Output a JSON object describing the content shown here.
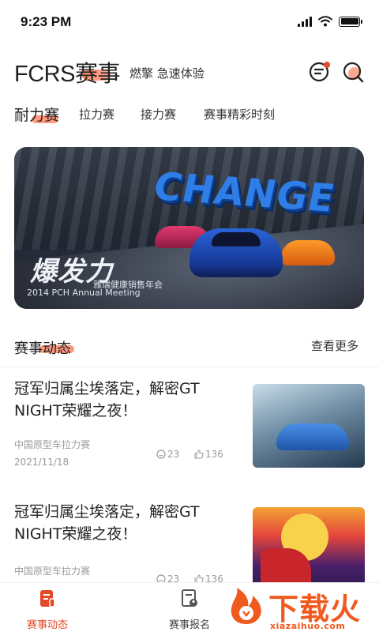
{
  "status_bar": {
    "time": "9:23 PM"
  },
  "header": {
    "title": "FCRS赛事",
    "subtitle": "燃擎 急速体验"
  },
  "tabs": [
    {
      "label": "耐力赛",
      "active": true
    },
    {
      "label": "拉力赛",
      "active": false
    },
    {
      "label": "接力赛",
      "active": false
    },
    {
      "label": "赛事精彩时刻",
      "active": false
    }
  ],
  "banner": {
    "headline": "CHANGE",
    "logo_text": "爆发力",
    "event_text": "2014 PCH Annual Meeting",
    "sub_text": "雅瑞健康销售年会"
  },
  "section": {
    "title": "赛事动态",
    "more_label": "查看更多"
  },
  "news": [
    {
      "title": "冠军归属尘埃落定，解密GT NIGHT荣耀之夜！",
      "source": "中国原型车拉力赛",
      "date": "2021/11/18",
      "comments": "23",
      "likes": "136"
    },
    {
      "title": "冠军归属尘埃落定，解密GT NIGHT荣耀之夜！",
      "source": "中国原型车拉力赛",
      "date": "",
      "comments": "23",
      "likes": "136"
    }
  ],
  "bottom_nav": [
    {
      "label": "赛事动态",
      "active": true
    },
    {
      "label": "赛事报名",
      "active": false
    }
  ],
  "watermark": {
    "text": "下载火",
    "url": "xiazaihuo.com"
  },
  "colors": {
    "accent": "#e24a2a",
    "accent_soft": "#ff6e46",
    "text_primary": "#222222",
    "text_muted": "#9a9a9a"
  }
}
